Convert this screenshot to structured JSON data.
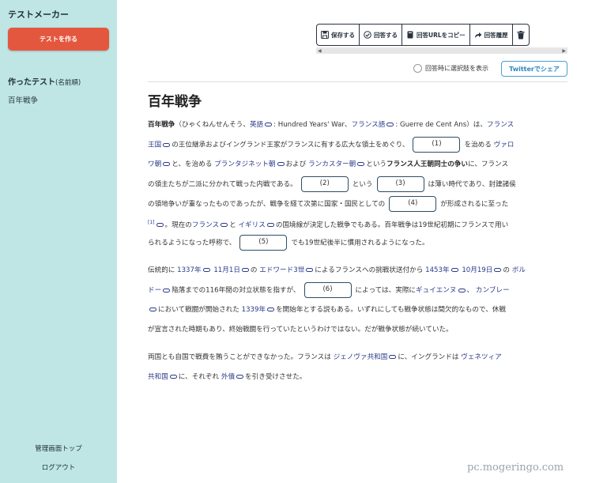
{
  "sidebar": {
    "app_title": "テストメーカー",
    "create_button": "テストを作る",
    "made_heading": "作ったテスト",
    "made_heading_sub": "(名前順)",
    "tests": [
      "百年戦争"
    ],
    "admin_top": "管理画面トップ",
    "logout": "ログアウト"
  },
  "toolbar": {
    "buttons": [
      {
        "label": "保存する",
        "icon": "save-icon"
      },
      {
        "label": "回答する",
        "icon": "check-circle-icon"
      },
      {
        "label": "回答URLをコピー",
        "icon": "book-icon"
      },
      {
        "label": "回答履歴",
        "icon": "share-icon"
      },
      {
        "label": "",
        "icon": "trash-icon"
      }
    ],
    "show_choices_label": "回答時に選択肢を表示",
    "share_button": "Twitterでシェア"
  },
  "article": {
    "title": "百年戦争",
    "p1": {
      "l1": {
        "t1": "百年戦争",
        "t2": "（ひゃくねんせんそう、",
        "t3": "英語",
        "t4": ": Hundred Years' War、",
        "t5": "フランス語",
        "t6": ": Guerre de Cent Ans）は、",
        "t7": "フランス"
      },
      "l2": {
        "t1": "王国",
        "t2": "の王位継承およびイングランド王家がフランスに有する広大な領土をめぐり、",
        "t3": "を治める",
        "t4": "ヴァロ"
      },
      "l3": {
        "t1": "ワ朝",
        "t2": "と、を治める",
        "t3": "プランタジネット朝",
        "t4": "および",
        "t5": "ランカスター朝",
        "t6": "という",
        "t7": "フランス人王朝同士の争い",
        "t8": "に、フランス"
      },
      "l4": {
        "t1": "の領主たちが二派に分かれて戦った内戦である。",
        "t2": "という",
        "t3": "は薄い時代であり、封建諸侯"
      },
      "l5": {
        "t1": "の領地争いが重なったものであったが、戦争を経て次第に国家・国民としての",
        "t2": "が形成されるに至った"
      },
      "l6": {
        "t1": "[1]",
        "t2": "。現在の",
        "t3": "フランス",
        "t4": "と",
        "t5": "イギリス",
        "t6": "の国境線が決定した戦争でもある。百年戦争は19世紀初期にフランスで用い"
      },
      "l7": {
        "t1": "られるようになった呼称で、",
        "t2": "でも19世紀後半に慣用されるようになった。"
      }
    },
    "p2": {
      "l1": {
        "t1": "伝統的に",
        "t2": "1337年",
        "t3": "11月1日",
        "t4": "の",
        "t5": "エドワード3世",
        "t6": "によるフランスへの挑戦状送付から",
        "t7": "1453年",
        "t8": "10月19日",
        "t9": "の",
        "t10": "ボル"
      },
      "l2": {
        "t1": "ドー",
        "t2": "陥落までの116年間の対立状態を指すが、",
        "t3": "によっては、実際に",
        "t4": "ギュイエンヌ",
        "t5": "、",
        "t6": "カンブレー"
      },
      "l3": {
        "t1": "において戦闘が開始された",
        "t2": "1339年",
        "t3": "を開始年とする説もある。いずれにしても戦争状態は間欠的なもので、休戦"
      },
      "l4": {
        "t1": "が宣言された時期もあり、終始戦闘を行っていたというわけではない。だが戦争状態が続いていた。"
      }
    },
    "p3": {
      "l1": {
        "t1": "両国とも自国で戦費を賄うことができなかった。フランスは",
        "t2": "ジェノヴァ共和国",
        "t3": "に、イングランドは",
        "t4": "ヴェネツィア"
      },
      "l2": {
        "t1": "共和国",
        "t2": "に、それぞれ",
        "t3": "外債",
        "t4": "を引き受けさせた。"
      }
    },
    "blanks": [
      "(1)",
      "(2)",
      "(3)",
      "(4)",
      "(5)",
      "(6)"
    ]
  },
  "watermark": "pc.mogeringo.com"
}
